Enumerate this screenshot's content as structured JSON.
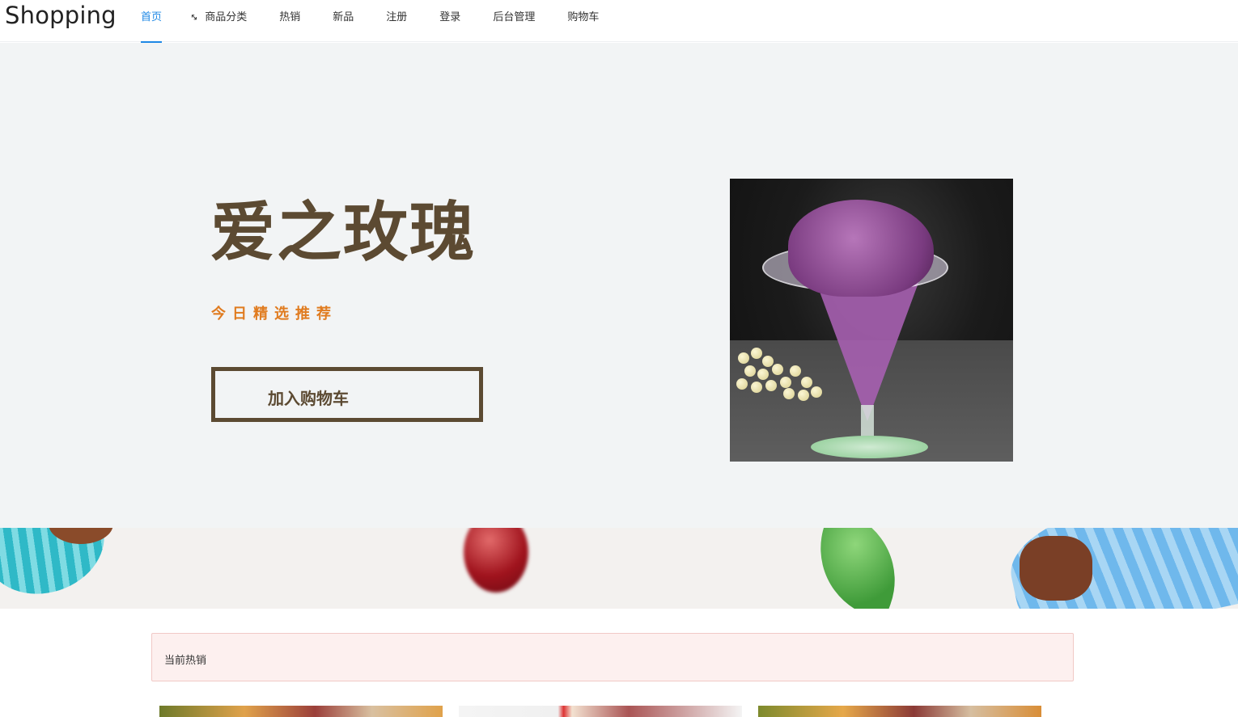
{
  "brand": "Shopping",
  "nav": {
    "items": [
      {
        "label": "首页",
        "active": true
      },
      {
        "label": "商品分类",
        "icon": "expand-arrows-icon"
      },
      {
        "label": "热销"
      },
      {
        "label": "新品"
      },
      {
        "label": "注册"
      },
      {
        "label": "登录"
      },
      {
        "label": "后台管理"
      },
      {
        "label": "购物车"
      }
    ]
  },
  "hero": {
    "title": "爱之玫瑰",
    "subtitle": "今日精选推荐",
    "cart_button": "加入购物车"
  },
  "hot_section": {
    "label": "当前热销"
  },
  "colors": {
    "accent": "#1e88e5",
    "title_brown": "#5c4a32",
    "subtitle_orange": "#e07b1f",
    "hero_bg": "#f2f4f5",
    "alert_bg": "#fdf0ef"
  }
}
